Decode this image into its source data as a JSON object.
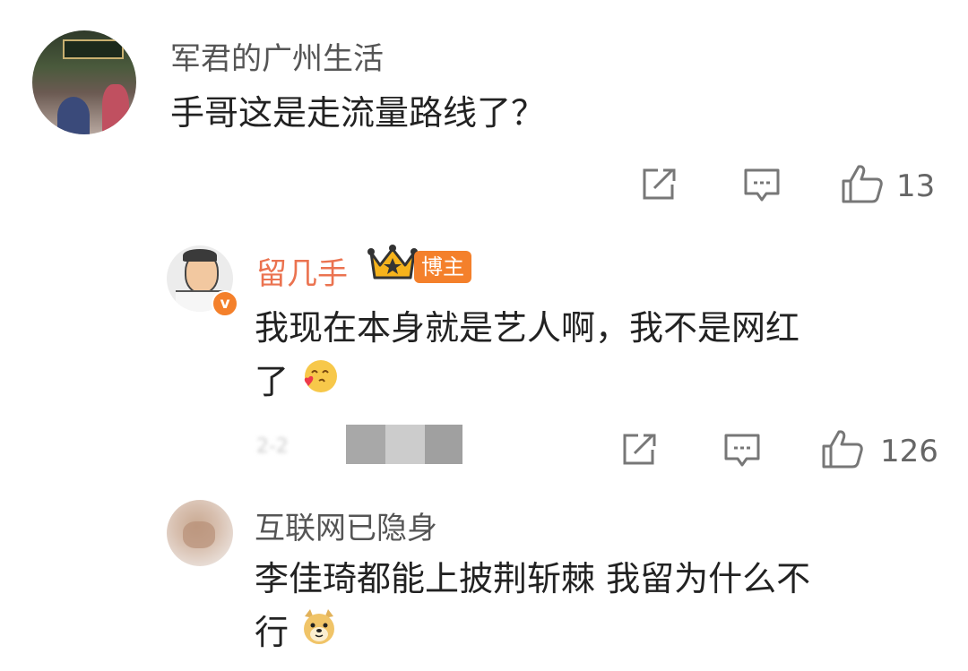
{
  "comments": [
    {
      "username": "军君的广州生活",
      "text": "手哥这是走流量路线了？",
      "like_count": "13",
      "icons": [
        "share-icon",
        "comment-icon",
        "like-icon"
      ]
    },
    {
      "username": "留几手",
      "badge": "博主",
      "text_line1": "我现在本身就是艺人啊，我不是网红",
      "text_line2": "了",
      "emoji": "kiss-face-emoji",
      "like_count": "126",
      "icons": [
        "crown-icon",
        "verified-icon",
        "share-icon",
        "comment-icon",
        "like-icon"
      ]
    },
    {
      "username": "互联网已隐身",
      "text_line1": "李佳琦都能上披荆斩棘 我留为什么不",
      "text_line2": "行",
      "emoji": "doge-emoji"
    }
  ],
  "colors": {
    "orange": "#eb7350",
    "badge": "#f4802b",
    "icon": "#777777"
  }
}
